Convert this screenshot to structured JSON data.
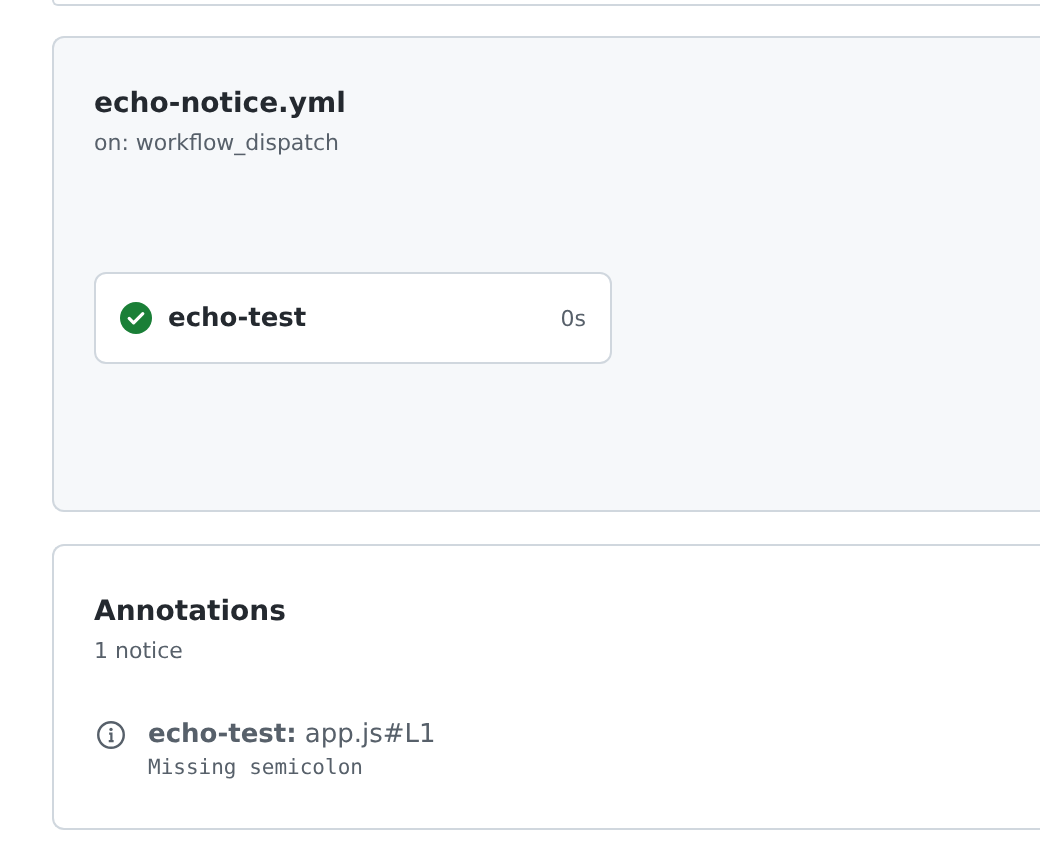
{
  "workflow": {
    "title": "echo-notice.yml",
    "trigger": "on: workflow_dispatch",
    "jobs": [
      {
        "name": "echo-test",
        "success": true,
        "duration": "0s"
      }
    ]
  },
  "annotations": {
    "title": "Annotations",
    "count": "1 notice",
    "items": [
      {
        "kind": "notice",
        "title": "**echo-test:** app.js#L1",
        "message": "Missing semicolon"
      }
    ]
  }
}
